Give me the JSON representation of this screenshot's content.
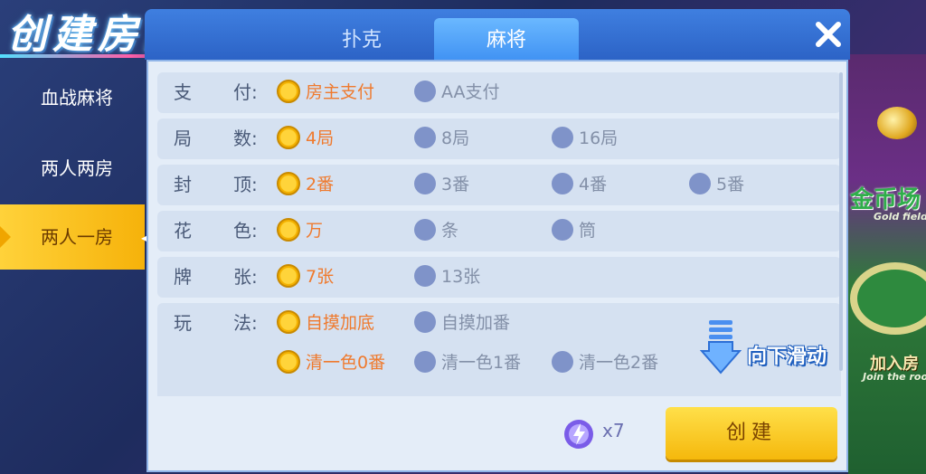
{
  "title": "创建房间",
  "tabs": [
    {
      "label": "扑克",
      "active": false
    },
    {
      "label": "麻将",
      "active": true
    }
  ],
  "sidebar": {
    "items": [
      {
        "label": "血战麻将",
        "active": false
      },
      {
        "label": "两人两房",
        "active": false
      },
      {
        "label": "两人一房",
        "active": true
      }
    ]
  },
  "rules": [
    {
      "label_a": "支",
      "label_b": "付:",
      "options": [
        {
          "text": "房主支付",
          "selected": true
        },
        {
          "text": "AA支付",
          "selected": false
        }
      ]
    },
    {
      "label_a": "局",
      "label_b": "数:",
      "options": [
        {
          "text": "4局",
          "selected": true
        },
        {
          "text": "8局",
          "selected": false
        },
        {
          "text": "16局",
          "selected": false
        }
      ]
    },
    {
      "label_a": "封",
      "label_b": "顶:",
      "options": [
        {
          "text": "2番",
          "selected": true
        },
        {
          "text": "3番",
          "selected": false
        },
        {
          "text": "4番",
          "selected": false
        },
        {
          "text": "5番",
          "selected": false
        }
      ]
    },
    {
      "label_a": "花",
      "label_b": "色:",
      "options": [
        {
          "text": "万",
          "selected": true
        },
        {
          "text": "条",
          "selected": false
        },
        {
          "text": "筒",
          "selected": false
        }
      ]
    },
    {
      "label_a": "牌",
      "label_b": "张:",
      "options": [
        {
          "text": "7张",
          "selected": true
        },
        {
          "text": "13张",
          "selected": false
        }
      ]
    },
    {
      "label_a": "玩",
      "label_b": "法:",
      "options": [
        {
          "text": "自摸加底",
          "selected": true
        },
        {
          "text": "自摸加番",
          "selected": false
        },
        {
          "text": "清一色0番",
          "selected": true
        },
        {
          "text": "清一色1番",
          "selected": false
        },
        {
          "text": "清一色2番",
          "selected": false
        }
      ]
    }
  ],
  "scroll_hint": "向下滑动",
  "footer": {
    "gem_count": "x7",
    "create_label": "创建"
  },
  "background": {
    "coin_title": "金币场",
    "coin_sub": "Gold field",
    "join_title": "加入房",
    "join_sub": "Join the room"
  },
  "colors": {
    "accent": "#f5b80c",
    "selected_text": "#ef7a2e",
    "tab_bar": "#3f7fe0"
  }
}
